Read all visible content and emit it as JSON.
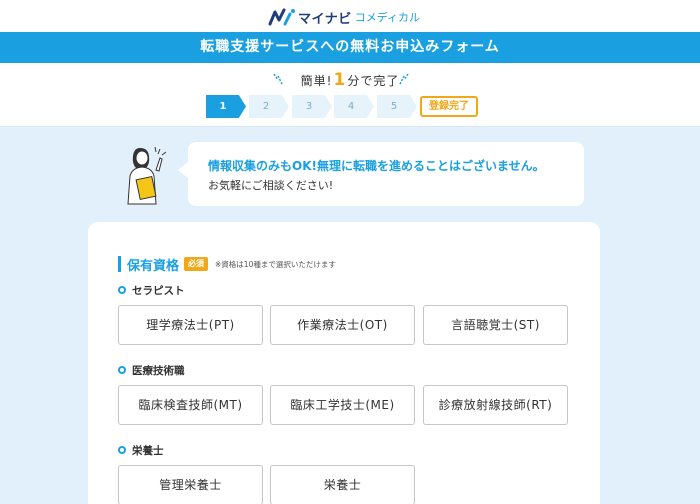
{
  "header": {
    "logo_main": "マイナビ",
    "logo_sub": "コメディカル",
    "logo_icon": "mynavi-m-logo-icon",
    "brand_color": "#1f3d7a"
  },
  "banner": {
    "title": "転職支援サービスへの無料お申込みフォーム",
    "bg_color": "#1aa0e0"
  },
  "time_note": {
    "prefix": "簡単!",
    "number": "1",
    "suffix": "分で完了"
  },
  "steps": {
    "items": [
      "1",
      "2",
      "3",
      "4",
      "5"
    ],
    "current": 1,
    "done_label": "登録完了"
  },
  "intro": {
    "main": "情報収集のみもOK!無理に転職を進めることはございません。",
    "sub": "お気軽にご相談ください!"
  },
  "form": {
    "section_title": "保有資格",
    "required_badge": "必須",
    "note": "※資格は10種まで選択いただけます",
    "groups": [
      {
        "label": "セラピスト",
        "options": [
          "理学療法士(PT)",
          "作業療法士(OT)",
          "言語聴覚士(ST)"
        ]
      },
      {
        "label": "医療技術職",
        "options": [
          "臨床検査技師(MT)",
          "臨床工学技士(ME)",
          "診療放射線技師(RT)"
        ]
      },
      {
        "label": "栄養士",
        "options": [
          "管理栄養士",
          "栄養士"
        ]
      }
    ]
  },
  "colors": {
    "accent": "#1aa0e0",
    "highlight": "#f0a818",
    "page_bg": "#e2f0fb"
  }
}
